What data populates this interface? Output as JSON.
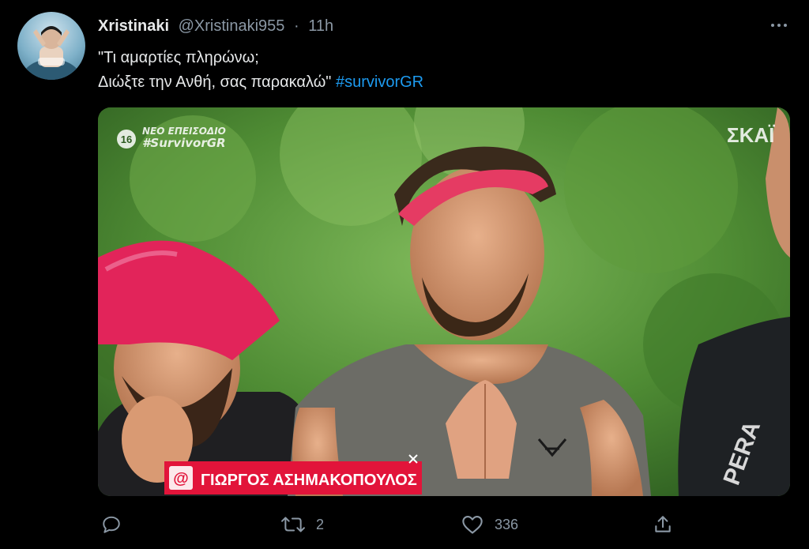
{
  "tweet": {
    "display_name": "Xristinaki",
    "handle": "@Xristinaki955",
    "separator": "·",
    "time": "11h",
    "text_line1": "\"Τι αμαρτίες πληρώνω;",
    "text_line2": "Διώξτε την Ανθή, σας παρακαλώ\"",
    "hashtag": "#survivorGR"
  },
  "media": {
    "age_rating": "16",
    "overlay_line1": "ΝΕΟ ΕΠΕΙΣΟΔΙΟ",
    "overlay_line2": "#SurvivorGR",
    "channel_logo": "ΣΚΑΪ",
    "lower_third_name": "ΓΙΩΡΓΟΣ ΑΣΗΜΑΚΟΠΟΥΛΟΣ",
    "lower_third_icon": "@",
    "shirt_text": "PERA"
  },
  "actions": {
    "reply_icon": "reply-icon",
    "retweet_icon": "retweet-icon",
    "retweet_count": "2",
    "like_icon": "like-icon",
    "like_count": "336",
    "share_icon": "share-icon"
  },
  "colors": {
    "background": "#000000",
    "text": "#e7e9ea",
    "secondary": "#8b98a5",
    "accent": "#1d9bf0"
  }
}
